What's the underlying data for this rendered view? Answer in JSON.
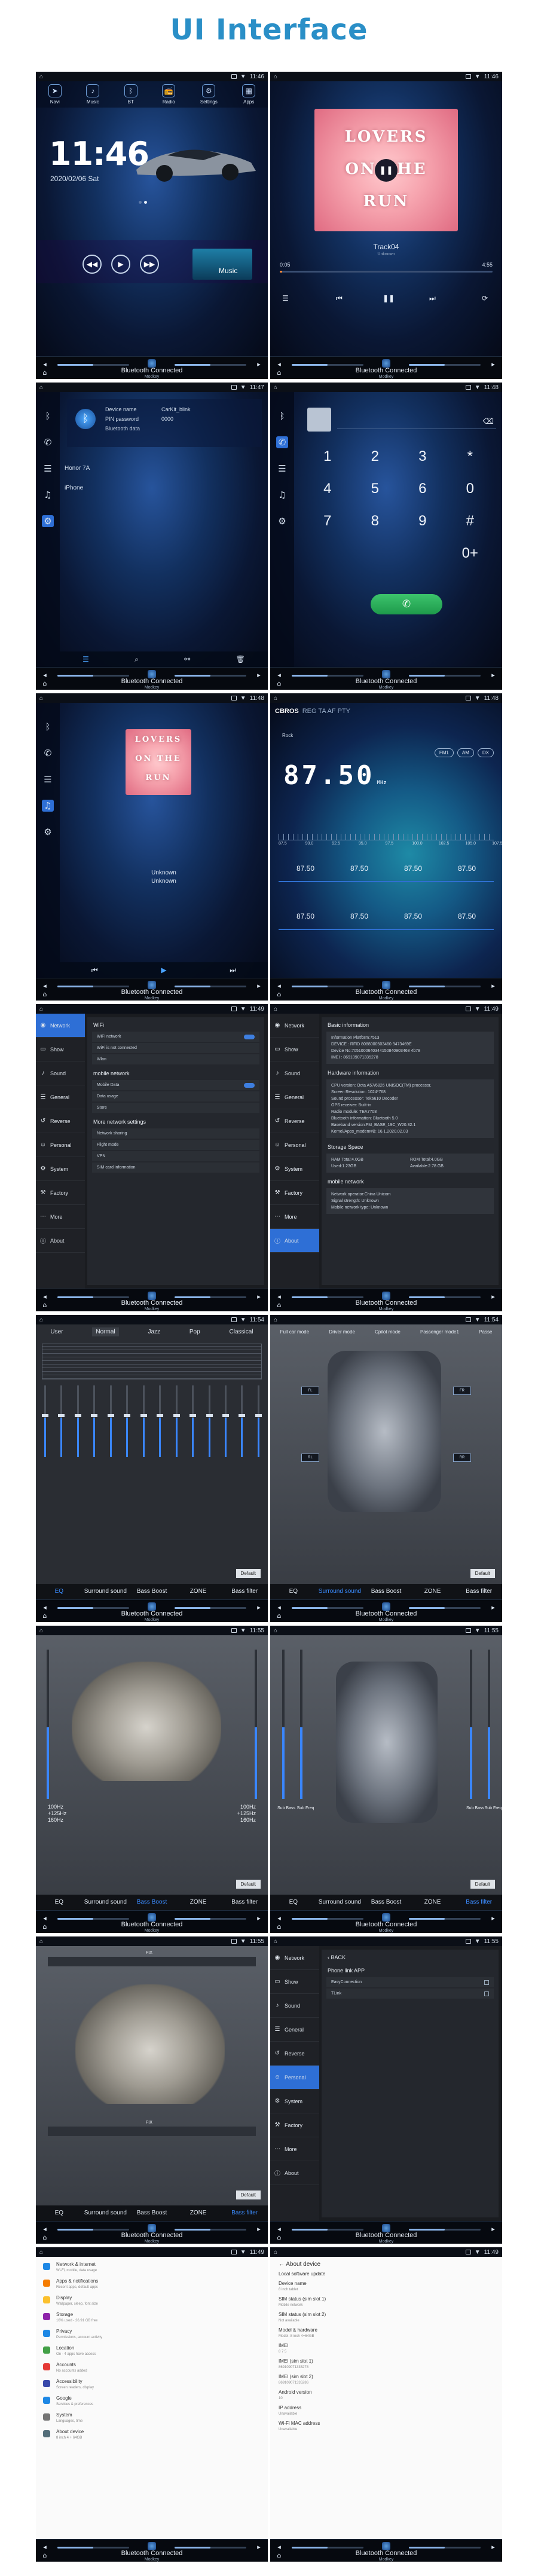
{
  "page_title": "UI Interface",
  "time": {
    "home": "11:46",
    "music": "11:46",
    "bt": "11:47",
    "dial": "11:48",
    "music2": "11:48",
    "radio": "11:48",
    "set1": "11:49",
    "set2": "11:49",
    "eq": "11:54",
    "car": "11:54",
    "seat": "11:55",
    "spk": "11:55",
    "seat2": "11:55",
    "set3": "11:55",
    "w1": "11:49",
    "w2": "11:49"
  },
  "bottom_bar": {
    "title": "Bluetooth Connected",
    "subtitle": "Modkey"
  },
  "home": {
    "apps": [
      {
        "label": "Navi",
        "icon": "navi-icon",
        "glyph": "➤"
      },
      {
        "label": "Music",
        "icon": "music-icon",
        "glyph": "♪"
      },
      {
        "label": "BT",
        "icon": "bluetooth-icon",
        "glyph": "ᛒ"
      },
      {
        "label": "Radio",
        "icon": "radio-icon",
        "glyph": "📻"
      },
      {
        "label": "Settings",
        "icon": "settings-icon",
        "glyph": "⚙"
      },
      {
        "label": "Apps",
        "icon": "apps-icon",
        "glyph": "▦"
      }
    ],
    "clock": "11:46",
    "date": "2020/02/06    Sat",
    "music_label": "Music"
  },
  "music": {
    "album_line1": "LOVERS",
    "album_line2": "ON THE",
    "album_line3": "RUN",
    "track": "Track04",
    "artist": "Unknown",
    "elapsed": "0:05",
    "total": "4:55"
  },
  "bluetooth": {
    "device_name_label": "Device name",
    "device_name": "CarKit_blink",
    "pin_label": "PIN password",
    "pin": "0000",
    "data_label": "Bluetooth data",
    "list": [
      "Honor 7A",
      "iPhone"
    ]
  },
  "dialer": {
    "keys": [
      "1",
      "2",
      "3",
      "*",
      "4",
      "5",
      "6",
      "0",
      "7",
      "8",
      "9",
      "#",
      "",
      "",
      "",
      "0+"
    ]
  },
  "music2": {
    "unknown1": "Unknown",
    "unknown2": "Unknown"
  },
  "radio": {
    "brand": "CBROS",
    "bands": "REG  TA  AF  PTY",
    "label": "Rock",
    "freq": "87.50",
    "unit": "MHz",
    "band_btns": [
      "FM1",
      "AM",
      "DX"
    ],
    "scale": [
      "87.5",
      "90.0",
      "92.5",
      "95.0",
      "97.5",
      "100.0",
      "102.5",
      "105.0",
      "107.5"
    ],
    "presets": [
      "87.50",
      "87.50",
      "87.50",
      "87.50",
      "87.50",
      "87.50",
      "87.50",
      "87.50"
    ]
  },
  "settings_menu": [
    "Network",
    "Show",
    "Sound",
    "General",
    "Reverse",
    "Personal",
    "System",
    "Factory",
    "More",
    "About"
  ],
  "settings1": {
    "wifi_header": "WiFi",
    "wifi_items": [
      "WiFi network",
      "WiFi is not connected",
      "Wlan"
    ],
    "mobile_header": "mobile network",
    "mobile_items": [
      "Mobile Data",
      "Data usage",
      "Store"
    ],
    "more_header": "More network settings",
    "more_items": [
      "Network sharing",
      "Flight mode",
      "VPN",
      "SIM card information"
    ]
  },
  "settings2": {
    "basic_header": "Basic information",
    "basic_lines": [
      "Information Platform:7513",
      "DEVICE : RFID   8088000503460 9473469E",
      "Device No:7051000640344150840903468 4b78",
      "IMEI : 869109071335278"
    ],
    "hw_header": "Hardware information",
    "hw_lines": [
      "CPU version: Octa A57/6826 UNISOC(TM) processor,",
      "Screen Resolution: 1024*768",
      "Sound processor: Tek6610 Decoder",
      "GPS receiver: Built-in",
      "Radio module: TEA7708",
      "Bluetooth information: Bluetooth 5.0",
      "Baseband version:FM_BASE_19C_W20.32.1",
      "Kernel/Apps_modem#B: 16.1.2020.02.03"
    ],
    "storage_header": "Storage Space",
    "storage": [
      {
        "k": "RAM",
        "v": "Total:4.0GB"
      },
      {
        "k": "ROM",
        "v": "Total:4.0GB"
      },
      {
        "k": "",
        "v": "Used:1.23GB"
      },
      {
        "k": "",
        "v": "Available:2.78 GB"
      }
    ],
    "mobile_header": "mobile network",
    "mobile_lines": [
      "Network operator:China Unicom",
      "Signal strength: Unknown",
      "Mobile network type: Unknown"
    ]
  },
  "eq": {
    "presets": [
      "User",
      "Normal",
      "Jazz",
      "Pop",
      "Classical"
    ],
    "default_label": "Default"
  },
  "sound_tabs": [
    "EQ",
    "Surround sound",
    "Bass Boost",
    "ZONE",
    "Bass filter"
  ],
  "car": {
    "modes": [
      "Full car mode",
      "Driver mode",
      "Cpilot mode",
      "Passenger mode1",
      "Passe"
    ],
    "spk_labels": [
      "FL",
      "FR",
      "RL",
      "RR"
    ]
  },
  "seat": {
    "left_hz": [
      "100Hz",
      "+125Hz",
      "160Hz"
    ],
    "right_hz": [
      "100Hz",
      "+125Hz",
      "160Hz"
    ]
  },
  "spk": {
    "labels": [
      "Sub Bass",
      "Sub Freq",
      "Sub Bass",
      "Sub Freq"
    ]
  },
  "seat2": {
    "top": "FIX",
    "bottom": "FIX"
  },
  "set3": {
    "back": "BACK",
    "header": "Phone link APP",
    "items": [
      "EasyConnection",
      "TLink"
    ]
  },
  "android1": [
    {
      "t": "Network & internet",
      "s": "Wi-Fi, mobile, data usage",
      "c": "#1e88e5"
    },
    {
      "t": "Apps & notifications",
      "s": "Recent apps, default apps",
      "c": "#f57c00"
    },
    {
      "t": "Display",
      "s": "Wallpaper, sleep, font size",
      "c": "#fbc02d"
    },
    {
      "t": "Storage",
      "s": "16% used - 26.91 GB free",
      "c": "#8e24aa"
    },
    {
      "t": "Privacy",
      "s": "Permissions, account activity",
      "c": "#1e88e5"
    },
    {
      "t": "Location",
      "s": "On - 4 apps have access",
      "c": "#43a047"
    },
    {
      "t": "Accounts",
      "s": "No accounts added",
      "c": "#e53935"
    },
    {
      "t": "Accessibility",
      "s": "Screen readers, display",
      "c": "#3949ab"
    },
    {
      "t": "Google",
      "s": "Services & preferences",
      "c": "#1e88e5"
    },
    {
      "t": "System",
      "s": "Languages, time",
      "c": "#757575"
    },
    {
      "t": "About device",
      "s": "8 inch 4 + 64GB",
      "c": "#546e7a"
    }
  ],
  "android2": {
    "title": "About device",
    "items": [
      {
        "t": "Local software update",
        "s": ""
      },
      {
        "t": "Device name",
        "s": "8 inch tablet"
      },
      {
        "t": "SIM status (sim slot 1)",
        "s": "Mobile network"
      },
      {
        "t": "SIM status (sim slot 2)",
        "s": "Not available"
      },
      {
        "t": "Model & hardware",
        "s": "Model: 8 inch 4+64GB"
      },
      {
        "t": "IMEI",
        "s": "8 7 5"
      },
      {
        "t": "IMEI (sim slot 1)",
        "s": "869109071335278"
      },
      {
        "t": "IMEI (sim slot 2)",
        "s": "869109071335286"
      },
      {
        "t": "Android version",
        "s": "10"
      },
      {
        "t": "IP address",
        "s": "Unavailable"
      },
      {
        "t": "Wi-Fi MAC address",
        "s": "Unavailable"
      }
    ]
  }
}
